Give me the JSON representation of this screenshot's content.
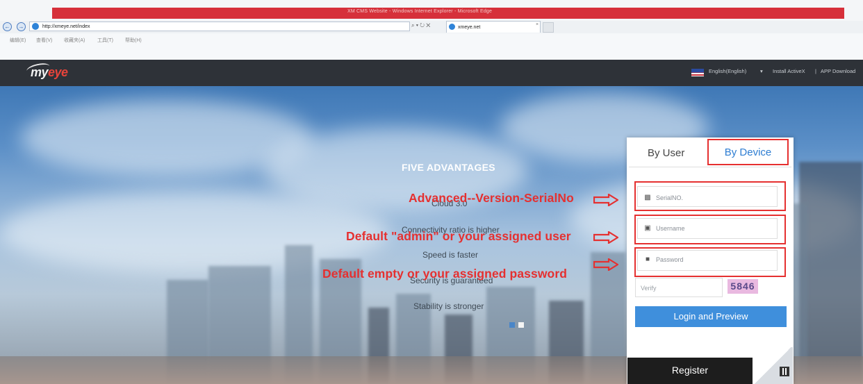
{
  "browser": {
    "window_title": "XM CMS Website - Windows Internet Explorer - Microsoft Edge",
    "address": "http://xmeye.net/index",
    "address_controls": "⌕ ▾ ↻ ✕",
    "tab_title": "xmeye.net",
    "tab_close": "×",
    "menu": [
      "编辑(E)",
      "查看(V)",
      "收藏夹(A)",
      "工具(T)",
      "帮助(H)"
    ]
  },
  "header": {
    "logo_prefix": "my",
    "logo_suffix": "eye",
    "language": "English(English)",
    "language_caret": "▾",
    "install_activex": "Install ActiveX",
    "separator": "|",
    "app_download": "APP Download"
  },
  "hero": {
    "title": "FIVE ADVANTAGES",
    "advantages": [
      "Cloud 3.0",
      "Connectivity ratio is higher",
      "Speed is faster",
      "Security is guaranteed",
      "Stability is stronger"
    ]
  },
  "annotations": {
    "serial": "Advanced--Version-SerialNo",
    "username": "Default \"admin\" or your assigned user",
    "password": "Default empty or your assigned password",
    "color": "#e53030"
  },
  "login": {
    "tab_user": "By User",
    "tab_device": "By Device",
    "serial_placeholder": "SerialNO.",
    "username_placeholder": "Username",
    "password_placeholder": "Password",
    "verify_placeholder": "Verify",
    "captcha": "5846",
    "login_button": "Login and Preview",
    "register_button": "Register",
    "accent_color": "#3f8fdc"
  }
}
